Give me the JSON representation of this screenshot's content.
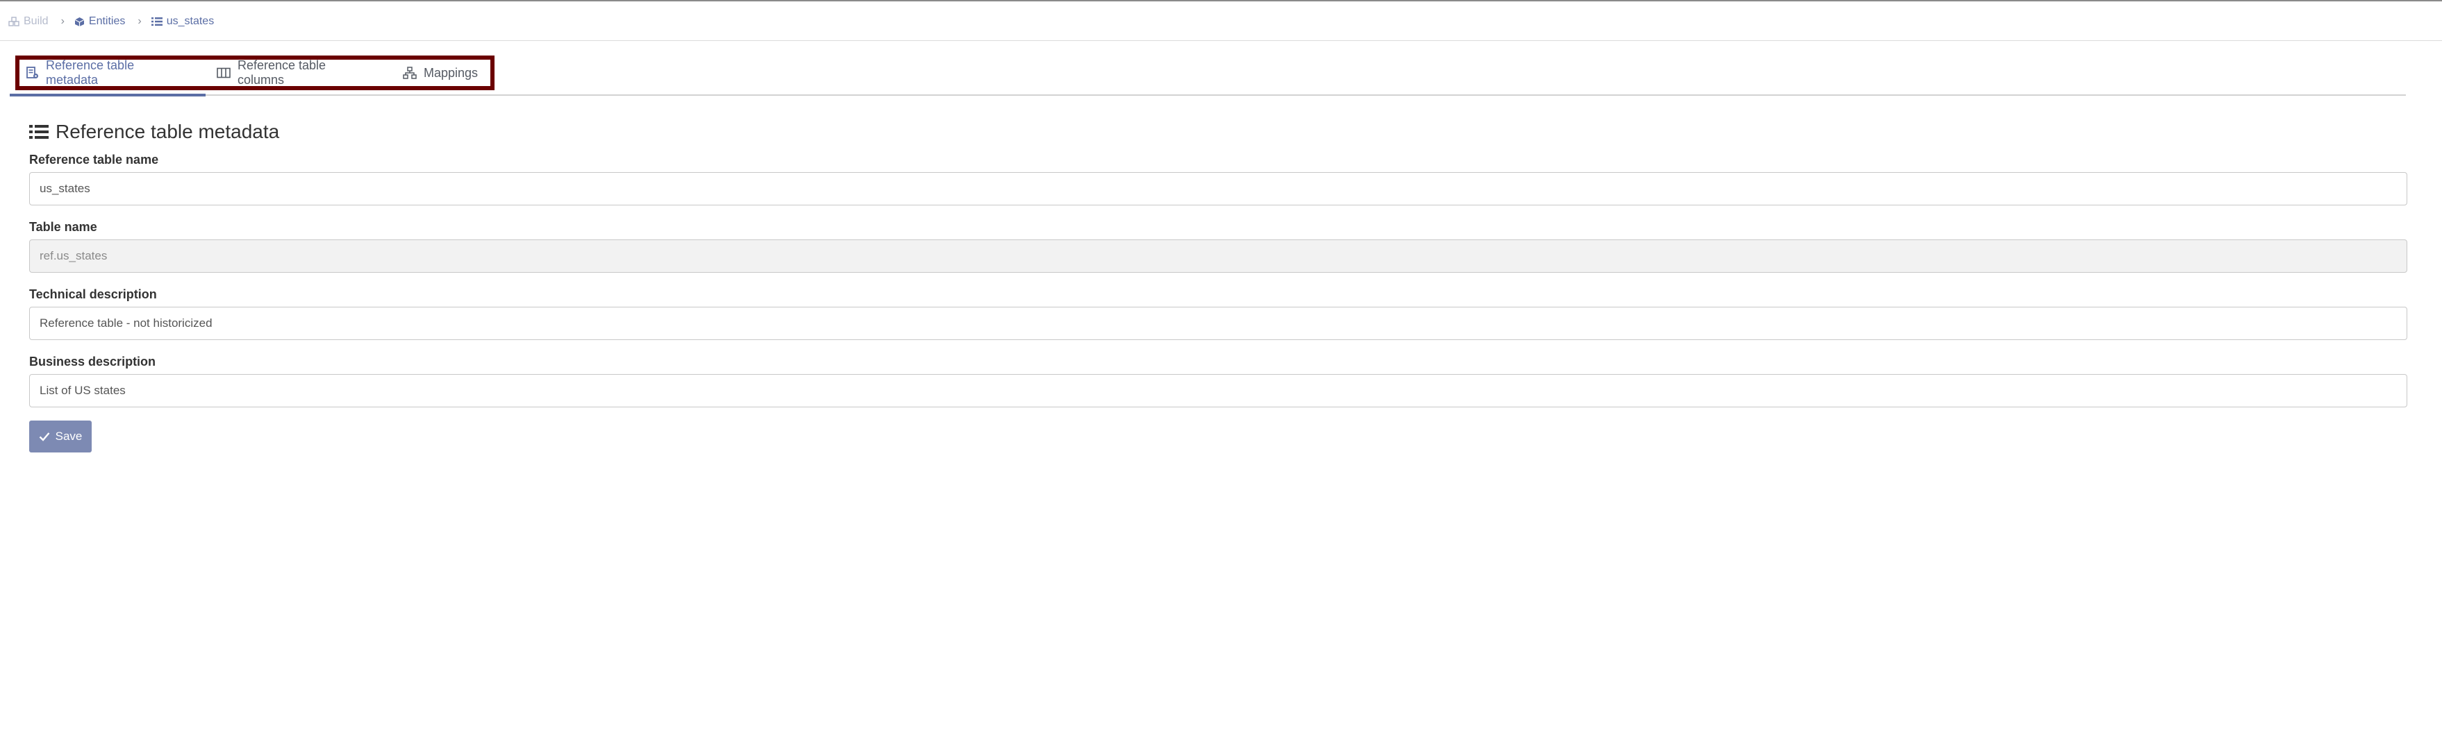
{
  "breadcrumb": {
    "items": [
      {
        "label": "Build",
        "icon": "cubes-icon"
      },
      {
        "label": "Entities",
        "icon": "cube-icon"
      },
      {
        "label": "us_states",
        "icon": "list-icon"
      }
    ]
  },
  "tabs": [
    {
      "label": "Reference table metadata",
      "icon": "table-settings-icon",
      "active": true
    },
    {
      "label": "Reference table columns",
      "icon": "columns-icon",
      "active": false
    },
    {
      "label": "Mappings",
      "icon": "sitemap-icon",
      "active": false
    }
  ],
  "section": {
    "title": "Reference table metadata",
    "icon": "list-icon"
  },
  "form": {
    "reference_table_name": {
      "label": "Reference table name",
      "value": "us_states"
    },
    "table_name": {
      "label": "Table name",
      "value": "ref.us_states",
      "readonly": true
    },
    "technical_description": {
      "label": "Technical description",
      "value": "Reference table - not historicized"
    },
    "business_description": {
      "label": "Business description",
      "value": "List of US states"
    }
  },
  "actions": {
    "save_label": "Save",
    "save_icon": "check-icon"
  },
  "colors": {
    "accent": "#5b6ea5",
    "save_button": "#7d8ab3",
    "highlight_border": "#6b0000"
  }
}
